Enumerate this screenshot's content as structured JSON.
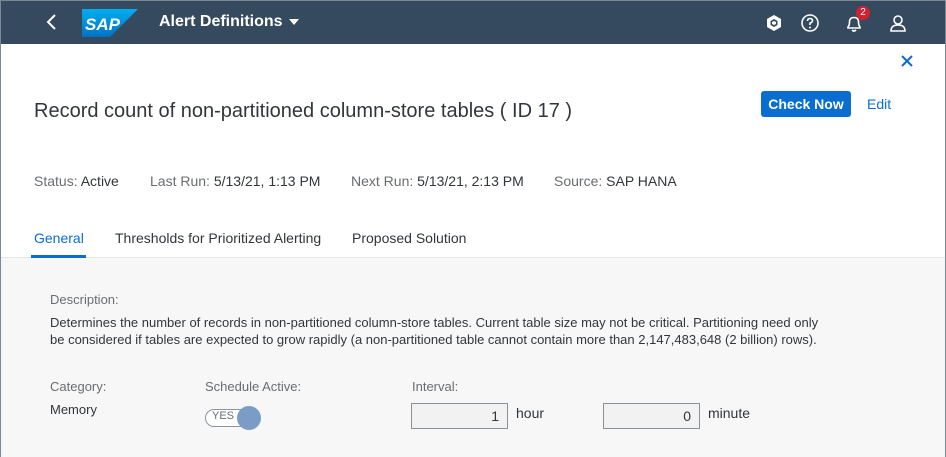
{
  "shell": {
    "app_title": "Alert Definitions",
    "notification_count": "2",
    "logo_text": "SAP",
    "icons": [
      "back-icon",
      "sap-logo",
      "caret-down-icon",
      "hana-cube-icon",
      "help-icon",
      "bell-icon",
      "user-icon"
    ]
  },
  "header": {
    "title": "Record count of non-partitioned column-store tables ( ID 17 )",
    "check_now": "Check Now",
    "edit": "Edit",
    "status_label": "Status:",
    "status_value": "Active",
    "last_run_label": "Last Run:",
    "last_run_value": "5/13/21, 1:13 PM",
    "next_run_label": "Next Run:",
    "next_run_value": "5/13/21, 2:13 PM",
    "source_label": "Source:",
    "source_value": "SAP HANA"
  },
  "tabs": [
    {
      "label": "General",
      "selected": true
    },
    {
      "label": "Thresholds for Prioritized Alerting",
      "selected": false
    },
    {
      "label": "Proposed Solution",
      "selected": false
    }
  ],
  "general": {
    "description_label": "Description:",
    "description_line1": "Determines the number of records in non-partitioned column-store tables. Current table size may not be critical. Partitioning need only",
    "description_line2": "be considered if tables are expected to grow rapidly (a non-partitioned table cannot contain more than 2,147,483,648 (2 billion) rows).",
    "category_label": "Category:",
    "category_value": "Memory",
    "schedule_label": "Schedule Active:",
    "schedule_value": "YES",
    "interval_label": "Interval:",
    "interval_hours": "1",
    "hours_unit": "hour",
    "interval_minutes": "0",
    "minutes_unit": "minute"
  },
  "colors": {
    "shell_bg": "#354a5f",
    "accent": "#0a6ed1",
    "badge": "#d32030"
  }
}
